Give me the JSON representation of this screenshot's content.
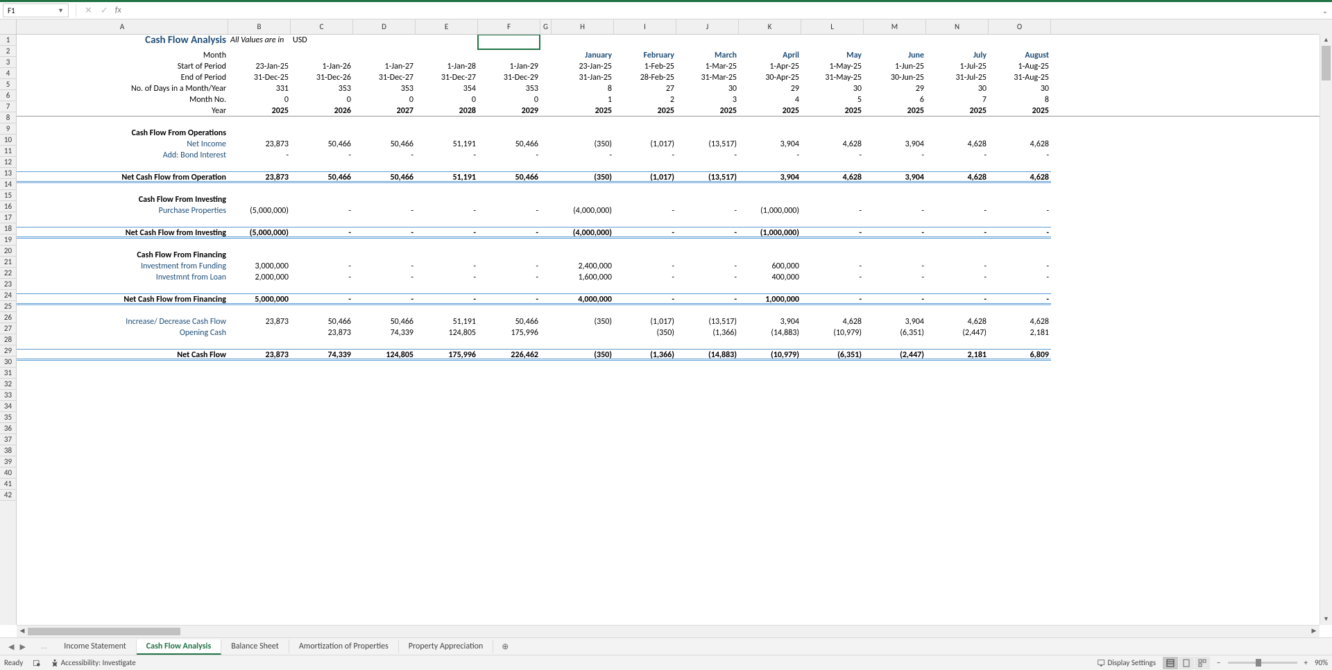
{
  "namebox": "F1",
  "fx": "fx",
  "formula_value": "",
  "col_widths": {
    "A": 305,
    "G": 16,
    "default": 90
  },
  "columns": [
    "A",
    "B",
    "C",
    "D",
    "E",
    "F",
    "G",
    "H",
    "I",
    "J",
    "K",
    "L",
    "M",
    "N",
    "O"
  ],
  "row_labels": [
    "1",
    "2",
    "3",
    "4",
    "5",
    "6",
    "7",
    "8",
    "9",
    "10",
    "11",
    "12",
    "13",
    "14",
    "15",
    "16",
    "17",
    "18",
    "19",
    "20",
    "21",
    "22",
    "23",
    "24",
    "25",
    "26",
    "27",
    "28",
    "29",
    "30",
    "31",
    "32",
    "33",
    "34",
    "35",
    "36",
    "37",
    "38",
    "39",
    "40",
    "41",
    "42"
  ],
  "title": "Cash Flow Analysis",
  "subtitle1": "All Values are in",
  "subtitle2": "USD",
  "labels": {
    "month": "Month",
    "start": "Start of Period",
    "end": "End of Period",
    "days": "No. of Days in a Month/Year",
    "monthno": "Month No.",
    "year": "Year",
    "cfo": "Cash Flow From Operations",
    "ni": "Net Income",
    "bond": "Add: Bond Interest",
    "ncfo": "Net Cash Flow from Operation",
    "cfi": "Cash Flow From Investing",
    "pp": "Purchase Properties",
    "ncfi": "Net Cash Flow from Investing",
    "cff": "Cash Flow From Financing",
    "iff": "Investment from Funding",
    "ifl": "Investmnt from Loan",
    "ncff": "Net Cash Flow from Financing",
    "idc": "Increase/ Decrease Cash Flow",
    "oc": "Opening Cash",
    "ncf": "Net Cash Flow"
  },
  "months": [
    "January",
    "February",
    "March",
    "April",
    "May",
    "June",
    "July",
    "August"
  ],
  "start_annual": [
    "23-Jan-25",
    "1-Jan-26",
    "1-Jan-27",
    "1-Jan-28",
    "1-Jan-29"
  ],
  "start_month": [
    "23-Jan-25",
    "1-Feb-25",
    "1-Mar-25",
    "1-Apr-25",
    "1-May-25",
    "1-Jun-25",
    "1-Jul-25",
    "1-Aug-25"
  ],
  "end_annual": [
    "31-Dec-25",
    "31-Dec-26",
    "31-Dec-27",
    "31-Dec-27",
    "31-Dec-29"
  ],
  "end_month": [
    "31-Jan-25",
    "28-Feb-25",
    "31-Mar-25",
    "30-Apr-25",
    "31-May-25",
    "30-Jun-25",
    "31-Jul-25",
    "31-Aug-25"
  ],
  "days_annual": [
    "331",
    "353",
    "353",
    "354",
    "353"
  ],
  "days_month": [
    "8",
    "27",
    "30",
    "29",
    "30",
    "29",
    "30",
    "30"
  ],
  "monthno_annual": [
    "0",
    "0",
    "0",
    "0",
    "0"
  ],
  "monthno_month": [
    "1",
    "2",
    "3",
    "4",
    "5",
    "6",
    "7",
    "8"
  ],
  "year_annual": [
    "2025",
    "2026",
    "2027",
    "2028",
    "2029"
  ],
  "year_month": [
    "2025",
    "2025",
    "2025",
    "2025",
    "2025",
    "2025",
    "2025",
    "2025"
  ],
  "ni_annual": [
    "23,873",
    "50,466",
    "50,466",
    "51,191",
    "50,466"
  ],
  "ni_month": [
    "(350)",
    "(1,017)",
    "(13,517)",
    "3,904",
    "4,628",
    "3,904",
    "4,628",
    "4,628"
  ],
  "bond_annual": [
    "-",
    "-",
    "-",
    "-",
    "-"
  ],
  "bond_month": [
    "-",
    "-",
    "-",
    "-",
    "-",
    "-",
    "-",
    "-"
  ],
  "ncfo_annual": [
    "23,873",
    "50,466",
    "50,466",
    "51,191",
    "50,466"
  ],
  "ncfo_month": [
    "(350)",
    "(1,017)",
    "(13,517)",
    "3,904",
    "4,628",
    "3,904",
    "4,628",
    "4,628"
  ],
  "pp_annual": [
    "(5,000,000)",
    "-",
    "-",
    "-",
    "-"
  ],
  "pp_month": [
    "(4,000,000)",
    "-",
    "-",
    "(1,000,000)",
    "-",
    "-",
    "-",
    "-"
  ],
  "ncfi_annual": [
    "(5,000,000)",
    "-",
    "-",
    "-",
    "-"
  ],
  "ncfi_month": [
    "(4,000,000)",
    "-",
    "-",
    "(1,000,000)",
    "-",
    "-",
    "-",
    "-"
  ],
  "iff_annual": [
    "3,000,000",
    "-",
    "-",
    "-",
    "-"
  ],
  "iff_month": [
    "2,400,000",
    "-",
    "-",
    "600,000",
    "-",
    "-",
    "-",
    "-"
  ],
  "ifl_annual": [
    "2,000,000",
    "-",
    "-",
    "-",
    "-"
  ],
  "ifl_month": [
    "1,600,000",
    "-",
    "-",
    "400,000",
    "-",
    "-",
    "-",
    "-"
  ],
  "ncff_annual": [
    "5,000,000",
    "-",
    "-",
    "-",
    "-"
  ],
  "ncff_month": [
    "4,000,000",
    "-",
    "-",
    "1,000,000",
    "-",
    "-",
    "-",
    "-"
  ],
  "idc_annual": [
    "23,873",
    "50,466",
    "50,466",
    "51,191",
    "50,466"
  ],
  "idc_month": [
    "(350)",
    "(1,017)",
    "(13,517)",
    "3,904",
    "4,628",
    "3,904",
    "4,628",
    "4,628"
  ],
  "oc_annual": [
    "",
    "23,873",
    "74,339",
    "124,805",
    "175,996"
  ],
  "oc_month": [
    "",
    "(350)",
    "(1,366)",
    "(14,883)",
    "(10,979)",
    "(6,351)",
    "(2,447)",
    "2,181"
  ],
  "ncf_annual": [
    "23,873",
    "74,339",
    "124,805",
    "175,996",
    "226,462"
  ],
  "ncf_month": [
    "(350)",
    "(1,366)",
    "(14,883)",
    "(10,979)",
    "(6,351)",
    "(2,447)",
    "2,181",
    "6,809"
  ],
  "tabs": [
    "Income Statement",
    "Cash Flow Analysis",
    "Balance Sheet",
    "Amortization of Properties",
    "Property Appreciation"
  ],
  "active_tab": 1,
  "status": {
    "ready": "Ready",
    "accessibility": "Accessibility: Investigate",
    "display": "Display Settings",
    "zoom": "90%"
  }
}
